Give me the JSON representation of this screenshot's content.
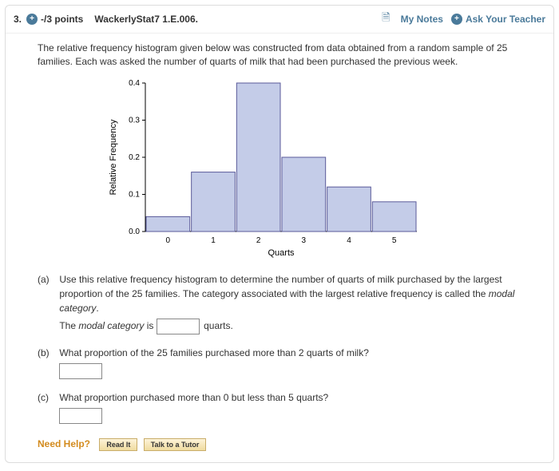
{
  "header": {
    "number": "3.",
    "points": "-/3 points",
    "reference": "WackerlyStat7 1.E.006.",
    "my_notes": "My Notes",
    "ask_teacher": "Ask Your Teacher"
  },
  "prompt": "The relative frequency histogram given below was constructed from data obtained from a random sample of 25 families. Each was asked the number of quarts of milk that had been purchased the previous week.",
  "parts": {
    "a": {
      "label": "(a)",
      "text": "Use this relative frequency histogram to determine the number of quarts of milk purchased by the largest proportion of the 25 families. The category associated with the largest relative frequency is called the ",
      "ital": "modal category",
      "period": ".",
      "line2_a": "The ",
      "line2_em": "modal category",
      "line2_b": " is ",
      "unit": " quarts."
    },
    "b": {
      "label": "(b)",
      "text": "What proportion of the 25 families purchased more than 2 quarts of milk?"
    },
    "c": {
      "label": "(c)",
      "text": "What proportion purchased more than 0 but less than 5 quarts?"
    }
  },
  "help": {
    "label": "Need Help?",
    "read": "Read It",
    "tutor": "Talk to a Tutor"
  },
  "chart_data": {
    "type": "bar",
    "title": "",
    "xlabel": "Quarts",
    "ylabel": "Relative Frequency",
    "categories": [
      0,
      1,
      2,
      3,
      4,
      5
    ],
    "values": [
      0.04,
      0.16,
      0.4,
      0.2,
      0.12,
      0.08
    ],
    "ylim": [
      0.0,
      0.4
    ],
    "yticks": [
      0.0,
      0.1,
      0.2,
      0.3,
      0.4
    ],
    "bar_color": "#c4cce8",
    "bar_stroke": "#5a5a9a"
  }
}
